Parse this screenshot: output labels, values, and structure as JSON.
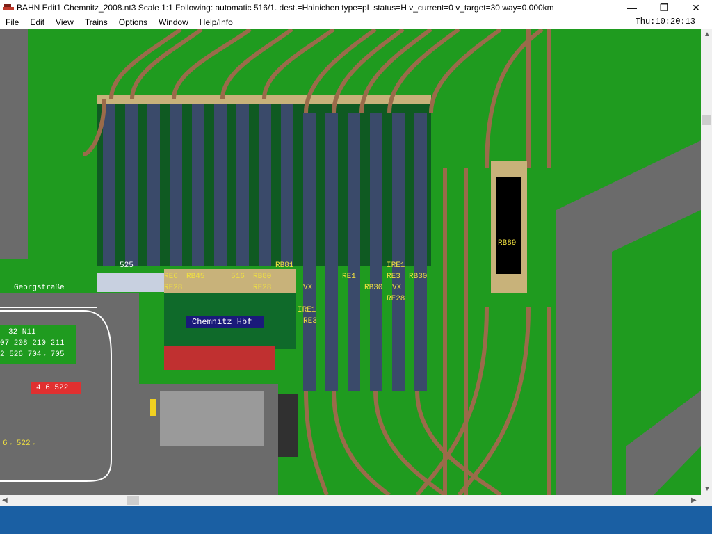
{
  "window": {
    "title": "BAHN Edit1 Chemnitz_2008.nt3 Scale 1:1 Following: automatic 516/1.  dest.=Hainichen type=pL status=H  v_current=0 v_target=30 way=0.000km",
    "minimize": "—",
    "maximize": "❐",
    "close": "✕"
  },
  "menu": {
    "items": [
      "File",
      "Edit",
      "View",
      "Trains",
      "Options",
      "Window",
      "Help/Info"
    ],
    "clock": "Thu:10:20:13"
  },
  "map": {
    "station_name": "Chemnitz Hbf",
    "street_name": "Georgstraße",
    "platform_labels": [
      {
        "text": "525",
        "color": "white"
      },
      {
        "text": "RE6",
        "color": "yellow"
      },
      {
        "text": "RB45",
        "color": "yellow"
      },
      {
        "text": "516",
        "color": "yellow"
      },
      {
        "text": "RB80",
        "color": "yellow"
      },
      {
        "text": "RB81",
        "color": "yellow"
      },
      {
        "text": "RE28",
        "color": "yellow"
      },
      {
        "text": "RE28",
        "color": "yellow"
      },
      {
        "text": "VX",
        "color": "yellow"
      },
      {
        "text": "RE1",
        "color": "yellow"
      },
      {
        "text": "RB30",
        "color": "yellow"
      },
      {
        "text": "VX",
        "color": "yellow"
      },
      {
        "text": "IRE1",
        "color": "yellow"
      },
      {
        "text": "RE3",
        "color": "yellow"
      },
      {
        "text": "RB30",
        "color": "yellow"
      },
      {
        "text": "RE28",
        "color": "yellow"
      },
      {
        "text": "IRE1",
        "color": "yellow"
      },
      {
        "text": "RE3",
        "color": "yellow"
      },
      {
        "text": "RB89",
        "color": "yellow"
      }
    ],
    "bus_board": {
      "line1": "32 N11",
      "line2": "07 208 210 211",
      "line3": "2 526 704→ 705"
    },
    "red_sign": "4 6 522",
    "route_sign": "6→ 522→"
  },
  "colors": {
    "grass": "#1f9b1f",
    "road": "#6b6b6b",
    "track": "#9a6b4a",
    "platform": "#c8b27a",
    "taskbar": "#1a5fa3"
  }
}
